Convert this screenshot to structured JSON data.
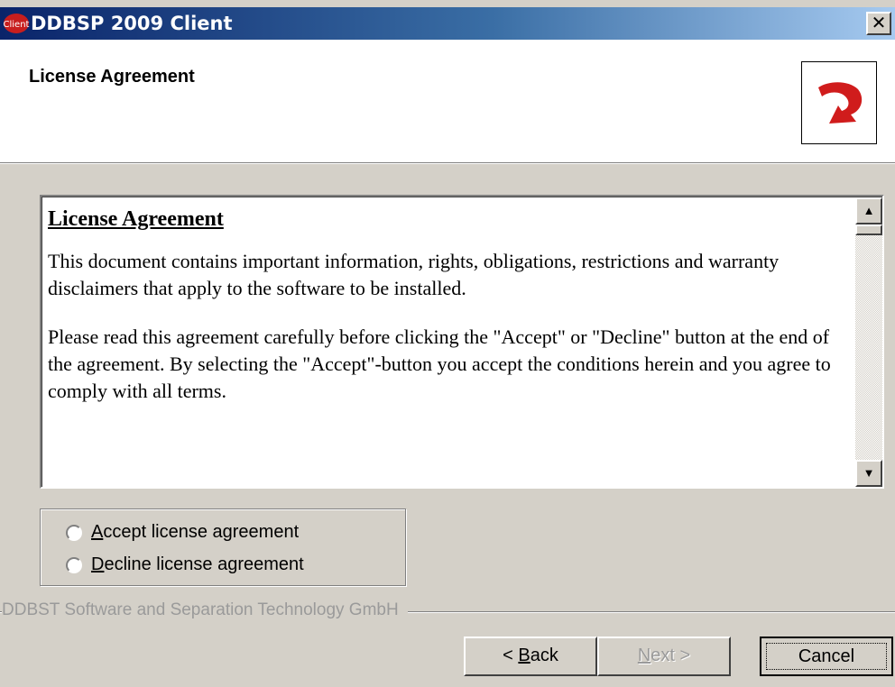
{
  "window": {
    "title": "DDBSP 2009 Client",
    "icon_text": "Client",
    "close_label": "✕"
  },
  "header": {
    "title": "License Agreement"
  },
  "license": {
    "heading": "License Agreement",
    "paragraph1": "This document contains important information, rights, obligations, restrictions and warranty disclaimers that apply to the software to be installed.",
    "paragraph2": "Please read this agreement carefully before clicking the \"Accept\" or \"Decline\" button at the end of the agreement. By selecting the \"Accept\"-button you accept the conditions herein and you agree to comply with all terms."
  },
  "options": {
    "accept": {
      "mnemonic": "A",
      "rest": "ccept license agreement",
      "selected": false
    },
    "decline": {
      "mnemonic": "D",
      "rest": "ecline license agreement",
      "selected": false
    }
  },
  "footer": {
    "company": "DDBST Software and Separation Technology GmbH"
  },
  "buttons": {
    "back": {
      "prefix": "< ",
      "mnemonic": "B",
      "rest": "ack"
    },
    "next": {
      "mnemonic": "N",
      "rest": "ext >",
      "enabled": false
    },
    "cancel": "Cancel"
  },
  "colors": {
    "title_gradient_start": "#0a246a",
    "title_gradient_end": "#a6caf0",
    "logo_red": "#d01c1c",
    "dialog_bg": "#d4d0c8"
  }
}
